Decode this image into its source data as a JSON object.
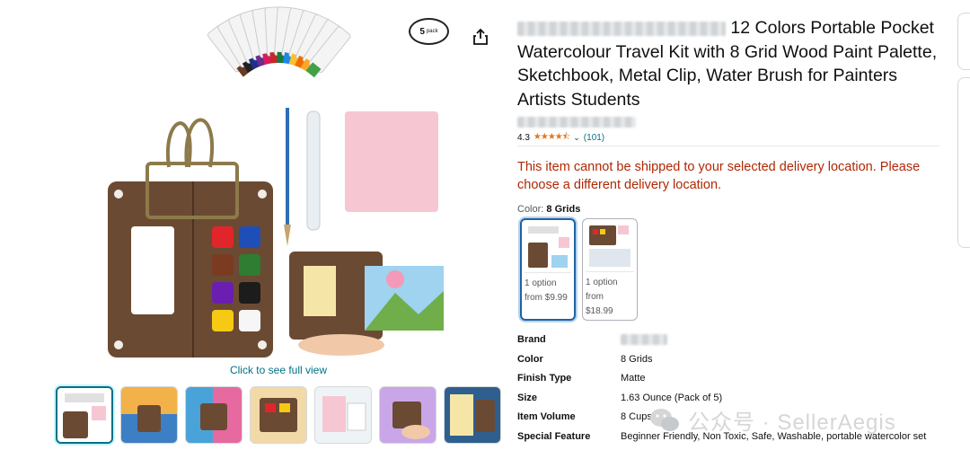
{
  "product": {
    "title_suffix": "12 Colors Portable Pocket",
    "title_rest": "Watercolour Travel Kit with 8 Grid Wood Paint Palette, Sketchbook, Metal Clip, Water Brush for Painters Artists Students"
  },
  "gallery": {
    "pack_badge_number": "5",
    "pack_badge_word": "pack",
    "see_full_view": "Click to see full view",
    "thumbnail_count": 7
  },
  "rating": {
    "value": "4.3",
    "stars_filled": 4.3,
    "stars_max": 5,
    "count": "(101)"
  },
  "delivery_warning": "This item cannot be shipped to your selected delivery location. Please choose a different delivery location.",
  "color_selector": {
    "label": "Color:",
    "selected": "8 Grids",
    "options": [
      {
        "line1": "1 option",
        "line2": "from $9.99"
      },
      {
        "line1": "1 option",
        "line2": "from",
        "line3": "$18.99"
      }
    ]
  },
  "specs": [
    {
      "key": "Brand",
      "value": ""
    },
    {
      "key": "Color",
      "value": "8 Grids"
    },
    {
      "key": "Finish Type",
      "value": "Matte"
    },
    {
      "key": "Size",
      "value": "1.63 Ounce (Pack of 5)"
    },
    {
      "key": "Item Volume",
      "value": "8 Cups"
    },
    {
      "key": "Special Feature",
      "value": "Beginner Friendly, Non Toxic, Safe, Washable, portable watercolor set"
    }
  ],
  "watermark": "公众号 · SellerAegis",
  "colors": {
    "link": "#007185",
    "warning": "#b12704",
    "star": "#de7921",
    "selected_border": "#2162a1"
  },
  "icons": [
    "share-icon",
    "star-icon",
    "chevron-down-icon",
    "wechat-icon"
  ]
}
